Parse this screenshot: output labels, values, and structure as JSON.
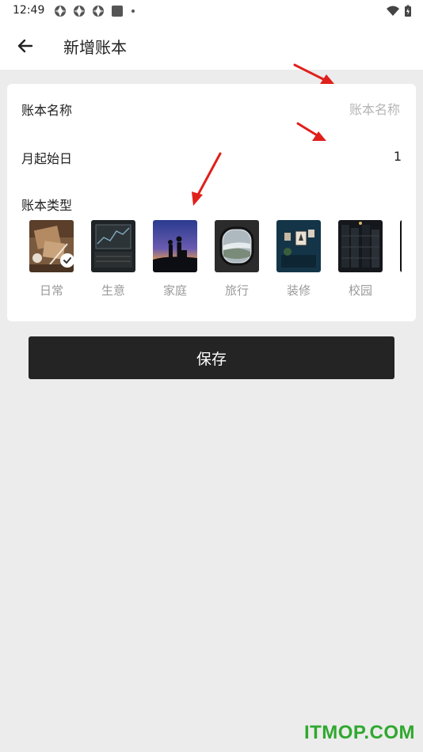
{
  "status": {
    "time": "12:49"
  },
  "header": {
    "title": "新增账本"
  },
  "form": {
    "name_label": "账本名称",
    "name_placeholder": "账本名称",
    "start_day_label": "月起始日",
    "start_day_value": "1",
    "type_label": "账本类型",
    "types": [
      {
        "label": "日常",
        "selected": true
      },
      {
        "label": "生意",
        "selected": false
      },
      {
        "label": "家庭",
        "selected": false
      },
      {
        "label": "旅行",
        "selected": false
      },
      {
        "label": "装修",
        "selected": false
      },
      {
        "label": "校园",
        "selected": false
      }
    ]
  },
  "actions": {
    "save_label": "保存"
  },
  "watermark": "ITMOP.COM",
  "colors": {
    "primary_button": "#242424",
    "annotation_arrow": "#e0201b",
    "watermark": "#2fa82e"
  }
}
